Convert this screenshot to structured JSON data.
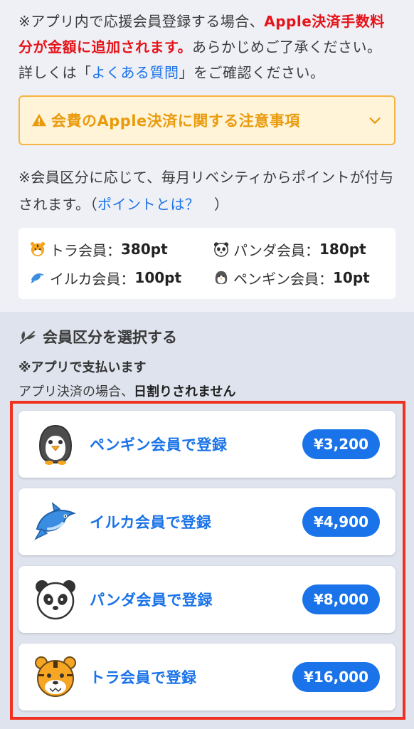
{
  "notice": {
    "pre": "※アプリ内で応援会員登録する場合、",
    "red": "Apple決済手数料分が金額に追加されます。",
    "mid": "あらかじめご了承ください。詳しくは「",
    "link": "よくある質問",
    "post": "」をご確認ください。"
  },
  "warning": {
    "title": "会費のApple決済に関する注意事項",
    "icon": "warning-triangle-icon"
  },
  "points_info": {
    "pre": "※会員区分に応じて、毎月リベシティからポイントが付与されます。（",
    "link": "ポイントとは？",
    "post": "　）"
  },
  "points": [
    {
      "emoji": "tiger-icon",
      "name": "トラ会員：",
      "value": "380pt"
    },
    {
      "emoji": "panda-icon",
      "name": "パンダ会員：",
      "value": "180pt"
    },
    {
      "emoji": "dolphin-icon",
      "name": "イルカ会員：",
      "value": "100pt"
    },
    {
      "emoji": "penguin-icon",
      "name": "ペンギン会員：",
      "value": "10pt"
    }
  ],
  "section": {
    "title": "会員区分を選択する",
    "sub1": "※アプリで支払います",
    "sub2_pre": "アプリ決済の場合、",
    "sub2_bold": "日割りされません"
  },
  "plans": [
    {
      "icon": "penguin-icon",
      "label": "ペンギン会員で登録",
      "price": "¥3,200"
    },
    {
      "icon": "dolphin-icon",
      "label": "イルカ会員で登録",
      "price": "¥4,900"
    },
    {
      "icon": "panda-icon",
      "label": "パンダ会員で登録",
      "price": "¥8,000"
    },
    {
      "icon": "tiger-icon",
      "label": "トラ会員で登録",
      "price": "¥16,000"
    }
  ],
  "colors": {
    "accent": "#1a73e8",
    "warning_text": "#ea9b0d",
    "warning_bg": "#fff4d8",
    "red": "#e5141a",
    "highlight_border": "#f0311f"
  }
}
